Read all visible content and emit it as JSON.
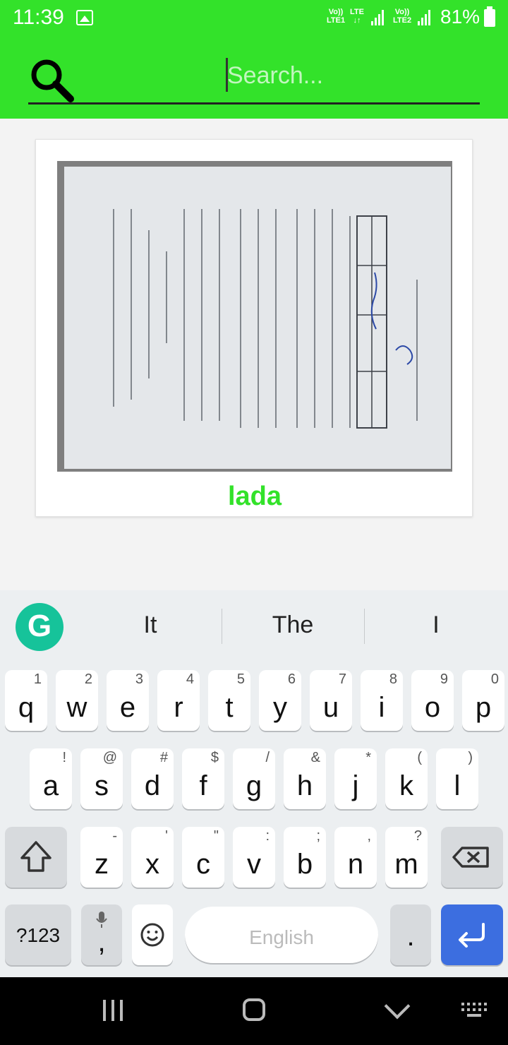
{
  "status_bar": {
    "time": "11:39",
    "sim1_top": "Vo))",
    "sim1_bottom": "LTE1",
    "lte_label": "LTE",
    "sim2_top": "Vo))",
    "sim2_bottom": "LTE2",
    "battery": "81%"
  },
  "search": {
    "placeholder": "Search..."
  },
  "card": {
    "title": "lada",
    "image_alt": "scanned document photo"
  },
  "suggestions": [
    "It",
    "The",
    "I"
  ],
  "keyboard": {
    "row1": [
      {
        "k": "q",
        "h": "1"
      },
      {
        "k": "w",
        "h": "2"
      },
      {
        "k": "e",
        "h": "3"
      },
      {
        "k": "r",
        "h": "4"
      },
      {
        "k": "t",
        "h": "5"
      },
      {
        "k": "y",
        "h": "6"
      },
      {
        "k": "u",
        "h": "7"
      },
      {
        "k": "i",
        "h": "8"
      },
      {
        "k": "o",
        "h": "9"
      },
      {
        "k": "p",
        "h": "0"
      }
    ],
    "row2": [
      {
        "k": "a",
        "h": "!"
      },
      {
        "k": "s",
        "h": "@"
      },
      {
        "k": "d",
        "h": "#"
      },
      {
        "k": "f",
        "h": "$"
      },
      {
        "k": "g",
        "h": "/"
      },
      {
        "k": "h",
        "h": "&"
      },
      {
        "k": "j",
        "h": "*"
      },
      {
        "k": "k",
        "h": "("
      },
      {
        "k": "l",
        "h": ")"
      }
    ],
    "row3": [
      {
        "k": "z",
        "h": "-"
      },
      {
        "k": "x",
        "h": "'"
      },
      {
        "k": "c",
        "h": "\""
      },
      {
        "k": "v",
        "h": ":"
      },
      {
        "k": "b",
        "h": ";"
      },
      {
        "k": "n",
        "h": ","
      },
      {
        "k": "m",
        "h": "?"
      }
    ],
    "symbols_label": "?123",
    "comma": ",",
    "period": ".",
    "space_label": "English"
  },
  "colors": {
    "accent_green": "#33e22a",
    "enter_blue": "#3c6ee0",
    "grammarly": "#16c39a"
  },
  "icons": {
    "search": "search-icon",
    "shift": "shift-icon",
    "backspace": "backspace-icon",
    "emoji": "emoji-icon",
    "mic": "mic-icon",
    "enter": "enter-icon"
  }
}
